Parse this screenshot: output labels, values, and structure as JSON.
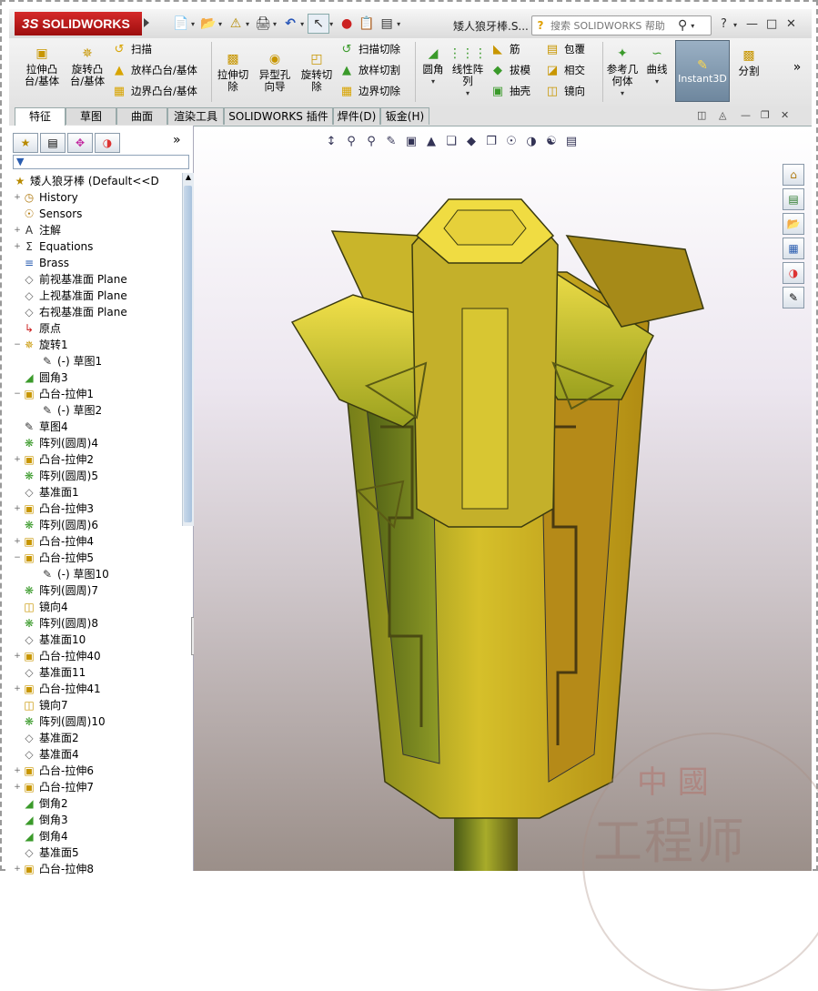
{
  "app": {
    "brand_prefix": "3S",
    "brand_name": "SOLIDWORKS",
    "doc_title": "矮人狼牙棒.S...",
    "search_placeholder": "搜索 SOLIDWORKS 帮助",
    "help_icon": "?"
  },
  "ribbon": {
    "extrude_boss": "拉伸凸\n台/基体",
    "revolve_boss": "旋转凸\n台/基体",
    "sweep": "扫描",
    "loft_boss": "放样凸台/基体",
    "boundary_boss": "边界凸台/基体",
    "extrude_cut": "拉伸切\n除",
    "hole_wizard": "异型孔\n向导",
    "revolve_cut": "旋转切\n除",
    "swept_cut": "扫描切除",
    "lofted_cut": "放样切割",
    "boundary_cut": "边界切除",
    "fillet": "圆角",
    "linear_pattern": "线性阵\n列",
    "rib": "筋",
    "draft": "拔模",
    "shell": "抽壳",
    "wrap": "包覆",
    "intersect": "相交",
    "mirror": "镜向",
    "ref_geometry": "参考几\n何体",
    "curves": "曲线",
    "instant3d": "Instant3D",
    "split": "分割",
    "more": "»"
  },
  "tabs": [
    "特征",
    "草图",
    "曲面",
    "渲染工具",
    "SOLIDWORKS 插件",
    "焊件(D)",
    "钣金(H)"
  ],
  "active_tab": 0,
  "tree": {
    "root": "矮人狼牙棒  (Default<<D",
    "expand_more": "»",
    "items": [
      {
        "label": "History",
        "icon": "history-icon",
        "exp": "+",
        "indent": 0
      },
      {
        "label": "Sensors",
        "icon": "sensor-icon",
        "exp": "",
        "indent": 0
      },
      {
        "label": "注解",
        "icon": "annotation-icon",
        "exp": "+",
        "indent": 0
      },
      {
        "label": "Equations",
        "icon": "equation-icon",
        "exp": "+",
        "indent": 0
      },
      {
        "label": "Brass",
        "icon": "material-icon",
        "exp": "",
        "indent": 0
      },
      {
        "label": "前视基准面 Plane",
        "icon": "plane-icon",
        "exp": "",
        "indent": 0
      },
      {
        "label": "上视基准面 Plane",
        "icon": "plane-icon",
        "exp": "",
        "indent": 0
      },
      {
        "label": "右视基准面 Plane",
        "icon": "plane-icon",
        "exp": "",
        "indent": 0
      },
      {
        "label": "原点",
        "icon": "origin-icon",
        "exp": "",
        "indent": 0
      },
      {
        "label": "旋转1",
        "icon": "revolve-icon",
        "exp": "−",
        "indent": 0
      },
      {
        "label": "(-) 草图1",
        "icon": "sketch-icon",
        "exp": "",
        "indent": 1
      },
      {
        "label": "圆角3",
        "icon": "fillet-icon",
        "exp": "",
        "indent": 0
      },
      {
        "label": "凸台-拉伸1",
        "icon": "extrude-icon",
        "exp": "−",
        "indent": 0
      },
      {
        "label": "(-) 草图2",
        "icon": "sketch-icon",
        "exp": "",
        "indent": 1
      },
      {
        "label": "草图4",
        "icon": "sketch-icon",
        "exp": "",
        "indent": 0
      },
      {
        "label": "阵列(圆周)4",
        "icon": "pattern-icon",
        "exp": "",
        "indent": 0
      },
      {
        "label": "凸台-拉伸2",
        "icon": "extrude-icon",
        "exp": "+",
        "indent": 0
      },
      {
        "label": "阵列(圆周)5",
        "icon": "pattern-icon",
        "exp": "",
        "indent": 0
      },
      {
        "label": "基准面1",
        "icon": "plane-icon",
        "exp": "",
        "indent": 0
      },
      {
        "label": "凸台-拉伸3",
        "icon": "extrude-icon",
        "exp": "+",
        "indent": 0
      },
      {
        "label": "阵列(圆周)6",
        "icon": "pattern-icon",
        "exp": "",
        "indent": 0
      },
      {
        "label": "凸台-拉伸4",
        "icon": "extrude-icon",
        "exp": "+",
        "indent": 0
      },
      {
        "label": "凸台-拉伸5",
        "icon": "extrude-icon",
        "exp": "−",
        "indent": 0
      },
      {
        "label": "(-) 草图10",
        "icon": "sketch-icon",
        "exp": "",
        "indent": 1
      },
      {
        "label": "阵列(圆周)7",
        "icon": "pattern-icon",
        "exp": "",
        "indent": 0
      },
      {
        "label": "镜向4",
        "icon": "mirror-icon",
        "exp": "",
        "indent": 0
      },
      {
        "label": "阵列(圆周)8",
        "icon": "pattern-icon",
        "exp": "",
        "indent": 0
      },
      {
        "label": "基准面10",
        "icon": "plane-icon",
        "exp": "",
        "indent": 0
      },
      {
        "label": "凸台-拉伸40",
        "icon": "extrude-icon",
        "exp": "+",
        "indent": 0
      },
      {
        "label": "基准面11",
        "icon": "plane-icon",
        "exp": "",
        "indent": 0
      },
      {
        "label": "凸台-拉伸41",
        "icon": "extrude-icon",
        "exp": "+",
        "indent": 0
      },
      {
        "label": "镜向7",
        "icon": "mirror-icon",
        "exp": "",
        "indent": 0
      },
      {
        "label": "阵列(圆周)10",
        "icon": "pattern-icon",
        "exp": "",
        "indent": 0
      },
      {
        "label": "基准面2",
        "icon": "plane-icon",
        "exp": "",
        "indent": 0
      },
      {
        "label": "基准面4",
        "icon": "plane-icon",
        "exp": "",
        "indent": 0
      },
      {
        "label": "凸台-拉伸6",
        "icon": "extrude-icon",
        "exp": "+",
        "indent": 0
      },
      {
        "label": "凸台-拉伸7",
        "icon": "extrude-icon",
        "exp": "+",
        "indent": 0
      },
      {
        "label": "倒角2",
        "icon": "chamfer-icon",
        "exp": "",
        "indent": 0
      },
      {
        "label": "倒角3",
        "icon": "chamfer-icon",
        "exp": "",
        "indent": 0
      },
      {
        "label": "倒角4",
        "icon": "chamfer-icon",
        "exp": "",
        "indent": 0
      },
      {
        "label": "基准面5",
        "icon": "plane-icon",
        "exp": "",
        "indent": 0
      },
      {
        "label": "凸台-拉伸8",
        "icon": "extrude-icon",
        "exp": "+",
        "indent": 0
      }
    ]
  },
  "watermark": {
    "top": "中 國",
    "bottom": "工程师"
  },
  "colors": {
    "brand_red": "#c41f1f",
    "model_gold": "#d4b21e",
    "model_green": "#6a7a1c"
  }
}
